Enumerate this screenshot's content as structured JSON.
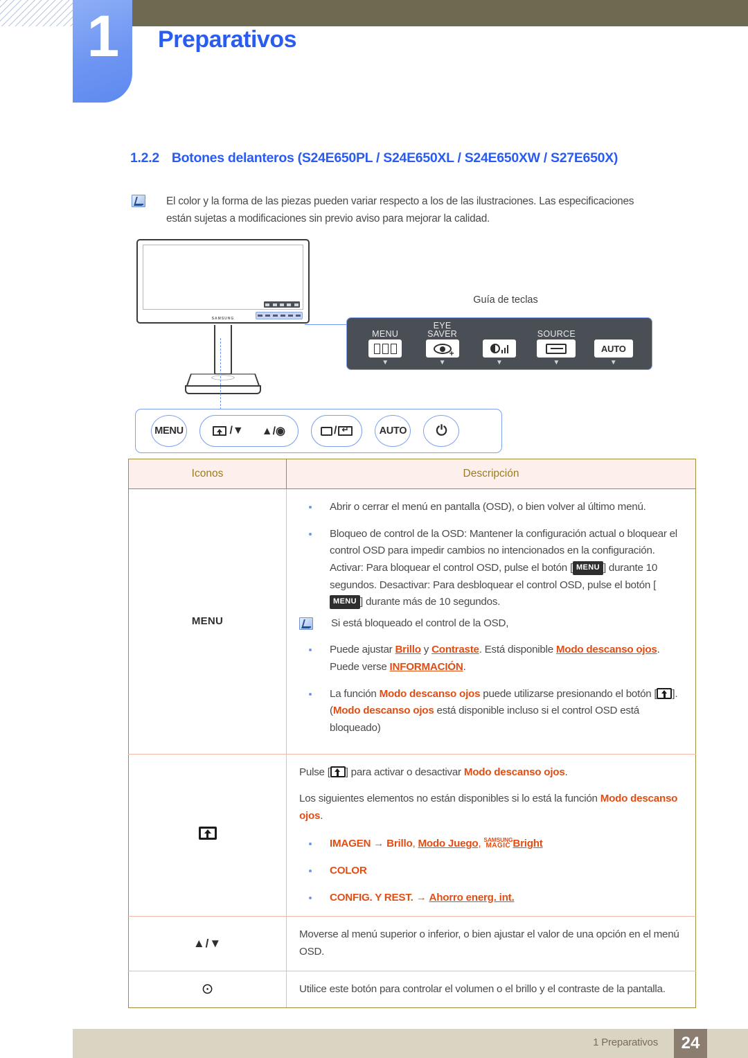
{
  "header": {
    "chapter_number": "1",
    "chapter_title": "Preparativos"
  },
  "section": {
    "number": "1.2.2",
    "title": "Botones delanteros (S24E650PL / S24E650XL / S24E650XW / S27E650X)"
  },
  "top_note": {
    "icon": "note-icon",
    "line1": "El color y la forma de las piezas pueden variar respecto a los de las ilustraciones. Las especificaciones",
    "line2": "están sujetas a modificaciones sin previo aviso para mejorar la calidad."
  },
  "illustration": {
    "monitor_brand": "SAMSUNG",
    "key_guide_label": "Guía de teclas",
    "key_guide": [
      {
        "caption": "MENU",
        "icon": "menu-bars-icon"
      },
      {
        "caption": "EYE\nSAVER",
        "icon": "eye-saver-icon"
      },
      {
        "caption": "",
        "icon": "brightness-volume-icon"
      },
      {
        "caption": "SOURCE",
        "icon": "source-icon"
      },
      {
        "caption": "",
        "icon": "auto-icon",
        "label": "AUTO"
      }
    ],
    "physical_buttons": [
      {
        "name": "menu-button",
        "label": "MENU"
      },
      {
        "name": "eyesaver-down-up-enter-pill",
        "label": "/ ▼      ▲ /"
      },
      {
        "name": "source-return-pill",
        "label": "/"
      },
      {
        "name": "auto-button",
        "label": "AUTO"
      },
      {
        "name": "power-button",
        "label": "⏻"
      }
    ]
  },
  "table": {
    "headers": [
      "Iconos",
      "Descripción"
    ],
    "rows": [
      {
        "icon_type": "text",
        "icon_label": "MENU",
        "bullets": [
          "Abrir o cerrar el menú en pantalla (OSD), o bien volver al último menú.",
          "Bloqueo de control de la OSD: Mantener la configuración actual o bloquear el control OSD para impedir cambios no intencionados en la configuración. Activar: Para bloquear el control OSD, pulse el botón [MENU] durante 10 segundos. Desactivar: Para desbloquear el control OSD, pulse el botón [MENU] durante más de 10 segundos."
        ],
        "inner_note": {
          "intro": "Si está bloqueado el control de la OSD,",
          "bullets": [
            "Puede ajustar Brillo y Contraste. Está disponible Modo descanso ojos. Puede verse INFORMACIÓN.",
            "La función Modo descanso ojos puede utilizarse presionando el botón [ ]. (Modo descanso ojos está disponible incluso si el control OSD está bloqueado)"
          ]
        }
      },
      {
        "icon_type": "eye-saver-box",
        "icon_label": "",
        "paragraphs": [
          "Pulse [ ] para activar o desactivar Modo descanso ojos.",
          "Los siguientes elementos no están disponibles si lo está la función Modo descanso ojos."
        ],
        "bullets": [
          "IMAGEN → Brillo, Modo Juego, SAMSUNG MAGIC Bright",
          "COLOR",
          "CONFIG. Y REST. → Ahorro energ. int."
        ]
      },
      {
        "icon_type": "text",
        "icon_label": "▲/▼",
        "text": "Moverse al menú superior o inferior, o bien ajustar el valor de una opción en el menú OSD."
      },
      {
        "icon_type": "dot",
        "icon_label": "⊙",
        "text": "Utilice este botón para controlar el volumen o el brillo y el contraste de la pantalla."
      }
    ]
  },
  "footer": {
    "label": "1 Preparativos",
    "page_number": "24"
  },
  "colors": {
    "chapter_blue": "#2a5cf0",
    "olive": "#6e6a52",
    "table_border_gold": "#a08a3c",
    "table_border_pink": "#f2b8a8",
    "header_bg": "#fdf0ec",
    "header_text": "#9a7b1e",
    "accent_orange": "#e04e14",
    "footer_bg": "#dad5c3",
    "footer_page_bg": "#8b7d70"
  }
}
